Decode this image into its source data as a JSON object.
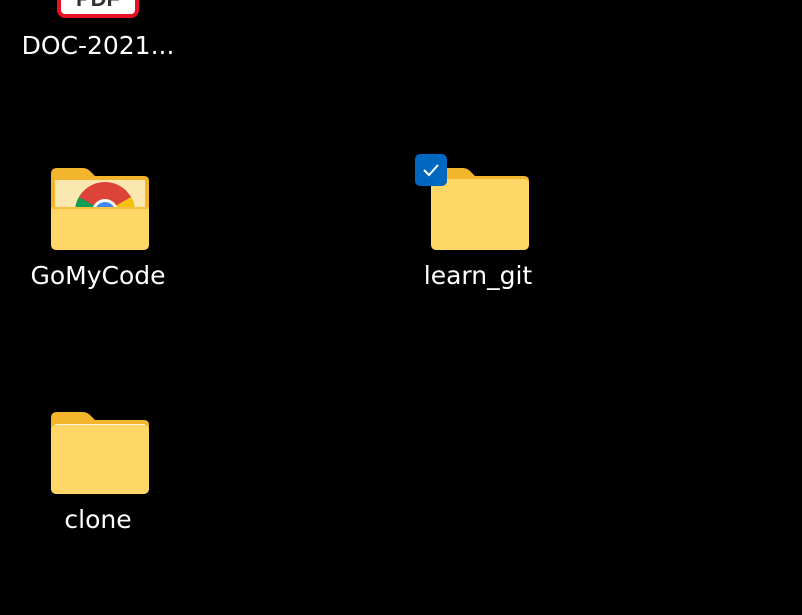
{
  "desktop": {
    "items": [
      {
        "label": "DOC-2021...",
        "type": "pdf-file",
        "badge": "PDF"
      },
      {
        "label": "GoMyCode",
        "type": "folder-with-chrome-shortcut"
      },
      {
        "label": "learn_git",
        "type": "folder",
        "selected": true
      },
      {
        "label": "clone",
        "type": "folder"
      }
    ]
  },
  "colors": {
    "background": "#000000",
    "folder_back": "#f2b52c",
    "folder_front": "#ffd766",
    "checkbox": "#0067c0",
    "pdf_border": "#e81123"
  }
}
